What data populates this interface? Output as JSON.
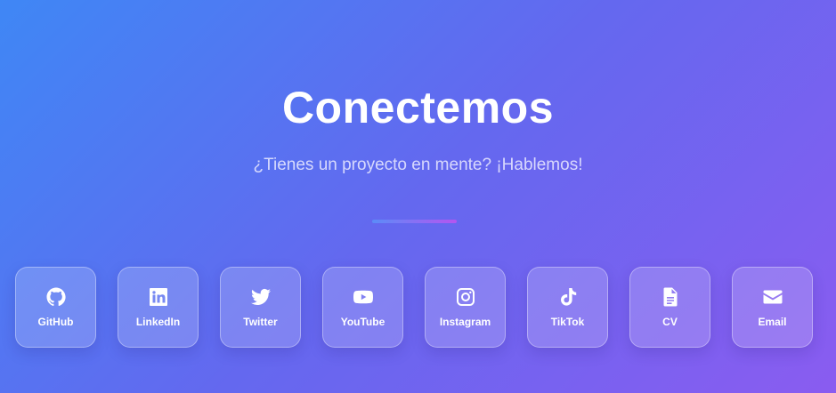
{
  "header": {
    "title": "Conectemos",
    "subtitle": "¿Tienes un proyecto en mente? ¡Hablemos!"
  },
  "colors": {
    "gradient_start": "#3f87f5",
    "gradient_end": "#8a5cf0",
    "divider_start": "#5b8cf8",
    "divider_end": "#b455f0"
  },
  "socials": [
    {
      "label": "GitHub",
      "icon": "github-icon"
    },
    {
      "label": "LinkedIn",
      "icon": "linkedin-icon"
    },
    {
      "label": "Twitter",
      "icon": "twitter-icon"
    },
    {
      "label": "YouTube",
      "icon": "youtube-icon"
    },
    {
      "label": "Instagram",
      "icon": "instagram-icon"
    },
    {
      "label": "TikTok",
      "icon": "tiktok-icon"
    },
    {
      "label": "CV",
      "icon": "document-icon"
    },
    {
      "label": "Email",
      "icon": "envelope-icon"
    }
  ]
}
